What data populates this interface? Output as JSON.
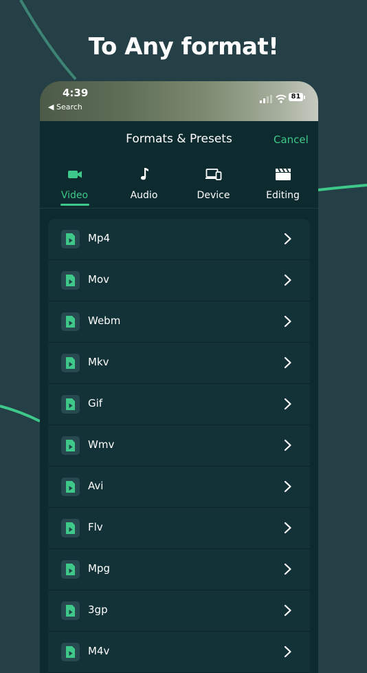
{
  "headline": "To Any format!",
  "status_bar": {
    "time": "4:39",
    "back_label": "◀ Search",
    "battery": "81"
  },
  "sheet": {
    "title": "Formats & Presets",
    "cancel_label": "Cancel"
  },
  "tabs": [
    {
      "label": "Video",
      "icon": "video-camera-icon",
      "active": true
    },
    {
      "label": "Audio",
      "icon": "music-note-icon",
      "active": false
    },
    {
      "label": "Device",
      "icon": "devices-icon",
      "active": false
    },
    {
      "label": "Editing",
      "icon": "clapperboard-icon",
      "active": false
    }
  ],
  "formats": [
    "Mp4",
    "Mov",
    "Webm",
    "Mkv",
    "Gif",
    "Wmv",
    "Avi",
    "Flv",
    "Mpg",
    "3gp",
    "M4v"
  ],
  "colors": {
    "background": "#253f47",
    "sheet": "#0d2a2f",
    "list_row": "#133238",
    "accent": "#3ec98a"
  }
}
